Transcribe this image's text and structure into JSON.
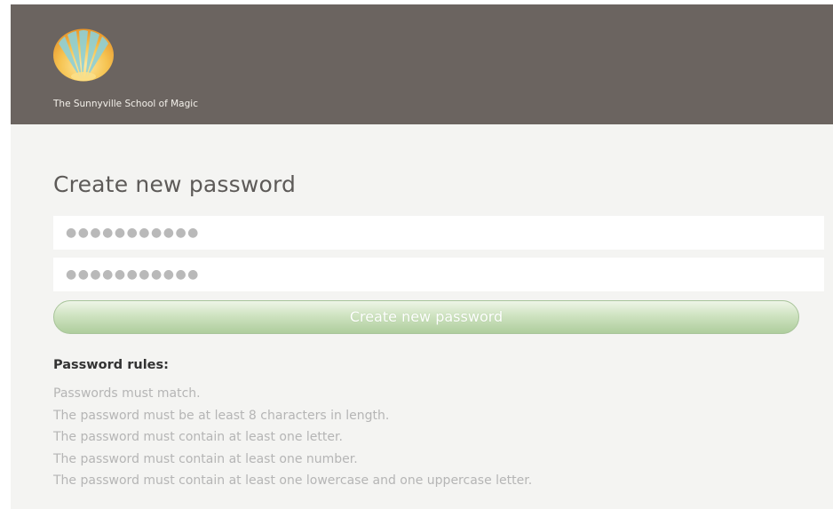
{
  "header": {
    "logo_icon": "sunburst-logo-icon",
    "school_name": "The Sunnyville School of Magic",
    "background_color": "#6b6460"
  },
  "form": {
    "title": "Create new password",
    "new_password_value": "●●●●●●●●●●●",
    "confirm_password_value": "●●●●●●●●●●●",
    "submit_label": "Create new password",
    "accent_color": "#aecd9d"
  },
  "rules": {
    "title": "Password rules:",
    "items": [
      "Passwords must match.",
      "The password must be at least 8 characters in length.",
      "The password must contain at least one letter.",
      "The password must contain at least one number.",
      "The password must contain at least one lowercase and one uppercase letter."
    ]
  }
}
